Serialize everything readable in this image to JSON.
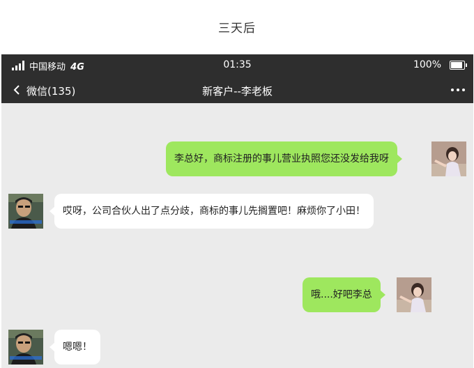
{
  "caption": "三天后",
  "status_bar": {
    "carrier": "中国移动",
    "network": "4G",
    "time": "01:35",
    "battery": "100%",
    "battery_level": 1.0,
    "signal_bars": 4
  },
  "nav": {
    "back_label": "微信(135)",
    "title": "新客户--李老板",
    "more_icon": "more-dots-icon",
    "back_icon": "chevron-left-icon"
  },
  "messages": [
    {
      "sender": "self",
      "text": "李总好，商标注册的事儿营业执照您还没发给我呀"
    },
    {
      "sender": "contact",
      "text": "哎呀，公司合伙人出了点分歧，商标的事儿先搁置吧！麻烦你了小田！"
    },
    {
      "sender": "self",
      "text": "哦....好吧李总"
    },
    {
      "sender": "contact",
      "text": "嗯嗯！"
    }
  ],
  "colors": {
    "status_bg": "#2e2e2e",
    "chat_bg": "#ebebeb",
    "outgoing_bubble": "#9ee75e",
    "incoming_bubble": "#ffffff"
  }
}
